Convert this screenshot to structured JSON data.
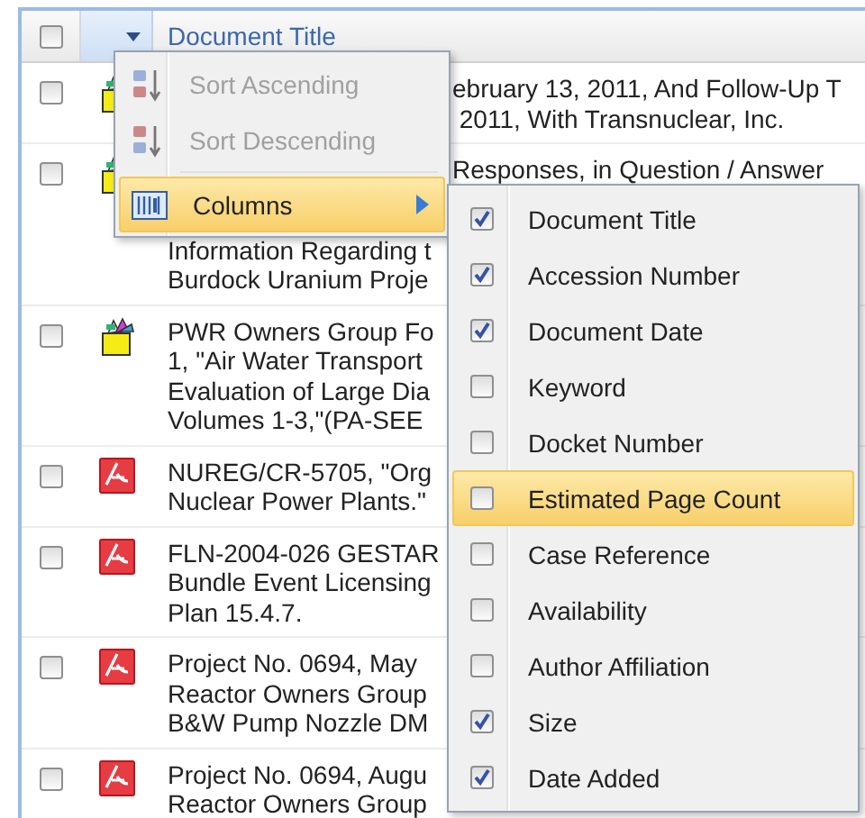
{
  "header": {
    "select_all_checked": false,
    "column_title": "Document Title"
  },
  "rows": [
    {
      "kind": "package",
      "checked": false,
      "lines": [
        {
          "text": "ebruary 13, 2011, And Follow-Up T",
          "after_menu": true
        },
        {
          "text": " 2011, With Transnuclear, Inc.",
          "after_menu": true
        }
      ]
    },
    {
      "kind": "package",
      "checked": false,
      "lines": [
        {
          "text": "Responses, in Question / Answer",
          "after_menu": true
        },
        {
          "text": "Information Regarding t"
        },
        {
          "text": "Burdock Uranium Proje",
          "after_menu": false
        }
      ]
    },
    {
      "kind": "package",
      "checked": false,
      "lines": [
        {
          "text": "PWR Owners Group Fo",
          "after_menu": false
        },
        {
          "text": "1, \"Air Water Transport",
          "after_menu": false
        },
        {
          "text": "Evaluation of Large Dia",
          "after_menu": false
        },
        {
          "text": "Volumes 1-3,\"(PA-SEE",
          "after_menu": false
        }
      ]
    },
    {
      "kind": "pdf",
      "checked": false,
      "lines": [
        {
          "text": "NUREG/CR-5705, \"Org",
          "after_menu": false
        },
        {
          "text": "Nuclear Power Plants.\"",
          "after_menu": false
        }
      ]
    },
    {
      "kind": "pdf",
      "checked": false,
      "lines": [
        {
          "text": "FLN-2004-026 GESTAR",
          "after_menu": false
        },
        {
          "text": "Bundle Event Licensing",
          "after_menu": false
        },
        {
          "text": "Plan 15.4.7.",
          "after_menu": false
        }
      ]
    },
    {
      "kind": "pdf",
      "checked": false,
      "lines": [
        {
          "text": "Project No. 0694, May",
          "after_menu": false
        },
        {
          "text": "Reactor Owners Group",
          "after_menu": false
        },
        {
          "text": "B&W Pump Nozzle DM",
          "after_menu": false
        }
      ]
    },
    {
      "kind": "pdf",
      "checked": false,
      "lines": [
        {
          "text": "Project No. 0694, Augu",
          "after_menu": false
        },
        {
          "text": "Reactor Owners Group",
          "after_menu": false
        }
      ]
    }
  ],
  "column_menu": {
    "items": [
      {
        "kind": "sort_ascending",
        "label": "Sort Ascending",
        "disabled": true,
        "highlighted": false
      },
      {
        "kind": "sort_descending",
        "label": "Sort Descending",
        "disabled": true,
        "highlighted": false
      },
      {
        "kind": "columns",
        "label": "Columns",
        "disabled": false,
        "highlighted": true
      }
    ]
  },
  "columns_submenu": {
    "items": [
      {
        "label": "Document Title",
        "checked": true,
        "highlighted": false
      },
      {
        "label": "Accession Number",
        "checked": true,
        "highlighted": false
      },
      {
        "label": "Document Date",
        "checked": true,
        "highlighted": false
      },
      {
        "label": "Keyword",
        "checked": false,
        "highlighted": false
      },
      {
        "label": "Docket Number",
        "checked": false,
        "highlighted": false
      },
      {
        "label": "Estimated Page Count",
        "checked": false,
        "highlighted": true
      },
      {
        "label": "Case Reference",
        "checked": false,
        "highlighted": false
      },
      {
        "label": "Availability",
        "checked": false,
        "highlighted": false
      },
      {
        "label": "Author Affiliation",
        "checked": false,
        "highlighted": false
      },
      {
        "label": "Size",
        "checked": true,
        "highlighted": false
      },
      {
        "label": "Date Added",
        "checked": true,
        "highlighted": false
      }
    ]
  }
}
